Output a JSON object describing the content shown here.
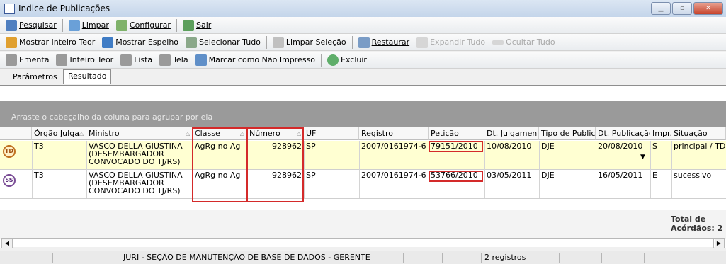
{
  "window": {
    "title": "Indice de Publicações",
    "controls": [
      "minimize-icon",
      "maximize-icon",
      "close-icon"
    ]
  },
  "toolbar1": {
    "pesquisar": "Pesquisar",
    "limpar": "Limpar",
    "configurar": "Configurar",
    "sair": "Sair"
  },
  "toolbar2": {
    "mostrar_inteiro_teor": "Mostrar Inteiro Teor",
    "mostrar_espelho": "Mostrar Espelho",
    "selecionar_tudo": "Selecionar Tudo",
    "limpar_selecao": "Limpar Seleção",
    "restaurar": "Restaurar",
    "expandir_tudo": "Expandir Tudo",
    "ocultar_tudo": "Ocultar Tudo"
  },
  "toolbar3": {
    "ementa": "Ementa",
    "inteiro_teor": "Inteiro Teor",
    "lista": "Lista",
    "tela": "Tela",
    "marcar_nao_impresso": "Marcar como Não Impresso",
    "excluir": "Excluir"
  },
  "tabs": {
    "parametros": "Parâmetros",
    "resultado": "Resultado"
  },
  "grid": {
    "group_hint": "Arraste o cabeçalho da coluna para agrupar por ela",
    "columns": {
      "orgao": "Órgão Julga",
      "ministro": "Ministro",
      "classe": "Classe",
      "numero": "Número",
      "uf": "UF",
      "registro": "Registro",
      "peticao": "Petição",
      "dt_julgamento": "Dt. Julgamento",
      "tipo_publica": "Tipo de Publica",
      "dt_publicacao": "Dt. Publicação",
      "impr": "Impr.",
      "situacao": "Situação"
    },
    "rows": [
      {
        "badge": "TD",
        "orgao": "T3",
        "ministro_l1": "VASCO DELLA GIUSTINA",
        "ministro_l2": "(DESEMBARGADOR",
        "ministro_l3": "CONVOCADO DO TJ/RS)",
        "classe": "AgRg no Ag",
        "numero": "928962",
        "uf": "SP",
        "registro": "2007/0161974-6",
        "peticao": "79151/2010",
        "dt_julgamento": "10/08/2010",
        "tipo_publica": "DJE",
        "dt_publicacao": "20/08/2010",
        "impr": "S",
        "situacao": "principal / TD"
      },
      {
        "badge": "SS",
        "orgao": "T3",
        "ministro_l1": "VASCO DELLA GIUSTINA",
        "ministro_l2": "(DESEMBARGADOR",
        "ministro_l3": "CONVOCADO DO TJ/RS)",
        "classe": "AgRg no Ag",
        "numero": "928962",
        "uf": "SP",
        "registro": "2007/0161974-6",
        "peticao": "53766/2010",
        "dt_julgamento": "03/05/2011",
        "tipo_publica": "DJE",
        "dt_publicacao": "16/05/2011",
        "impr": "E",
        "situacao": "sucessivo"
      }
    ],
    "total_l1": "Total de",
    "total_l2": "Acórdãos: 2"
  },
  "statusbar": {
    "user": "JURI - SEÇÃO DE MANUTENÇÃO DE BASE DE DADOS - GERENTE",
    "count": "2 registros"
  },
  "colors": {
    "highlight_row": "#ffffd2",
    "group_bar": "#9a9a9a",
    "annotation_box": "#d42a2a"
  }
}
